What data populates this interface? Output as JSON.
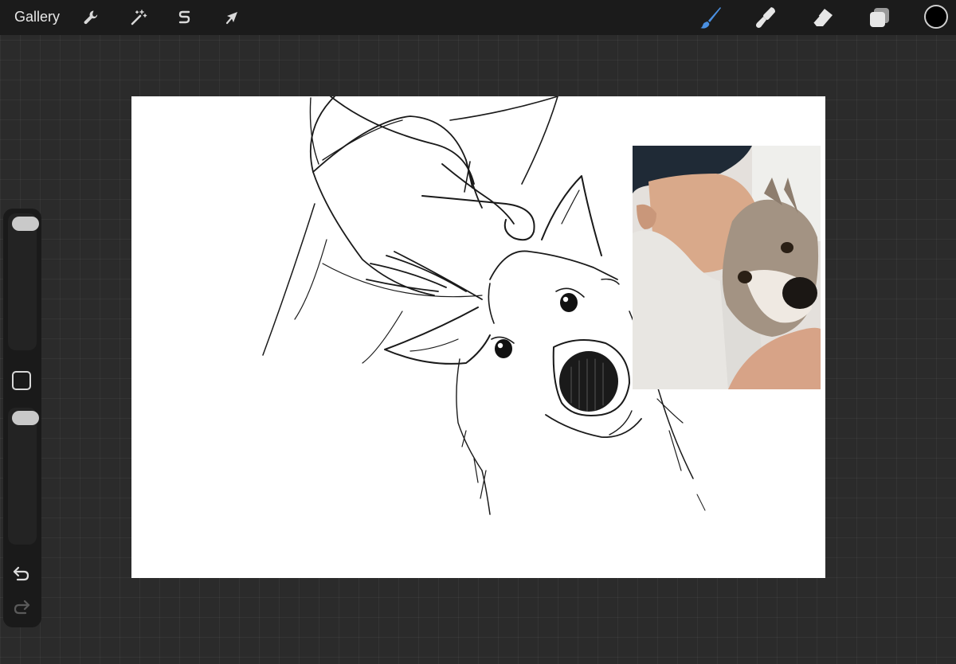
{
  "toolbar": {
    "gallery_label": "Gallery",
    "left_tools": [
      {
        "name": "actions",
        "icon": "wrench-icon"
      },
      {
        "name": "adjustments",
        "icon": "magic-wand-icon"
      },
      {
        "name": "selection",
        "icon": "selection-s-icon"
      },
      {
        "name": "transform",
        "icon": "arrow-cursor-icon"
      }
    ],
    "right_tools": [
      {
        "name": "brush",
        "icon": "brush-icon",
        "active": true
      },
      {
        "name": "smudge",
        "icon": "smudge-finger-icon"
      },
      {
        "name": "eraser",
        "icon": "eraser-icon"
      },
      {
        "name": "layers",
        "icon": "layers-icon"
      }
    ],
    "current_color": "#000000",
    "active_color": "#4a90e2"
  },
  "sidebar": {
    "brush_size_level": 0.0,
    "opacity_level": 0.0,
    "modify_icon": "square-icon",
    "undo_icon": "undo-arrow-icon",
    "redo_icon": "redo-arrow-icon"
  },
  "canvas": {
    "background": "#ffffff",
    "reference_photo": "person-kissing-husky-photo"
  }
}
